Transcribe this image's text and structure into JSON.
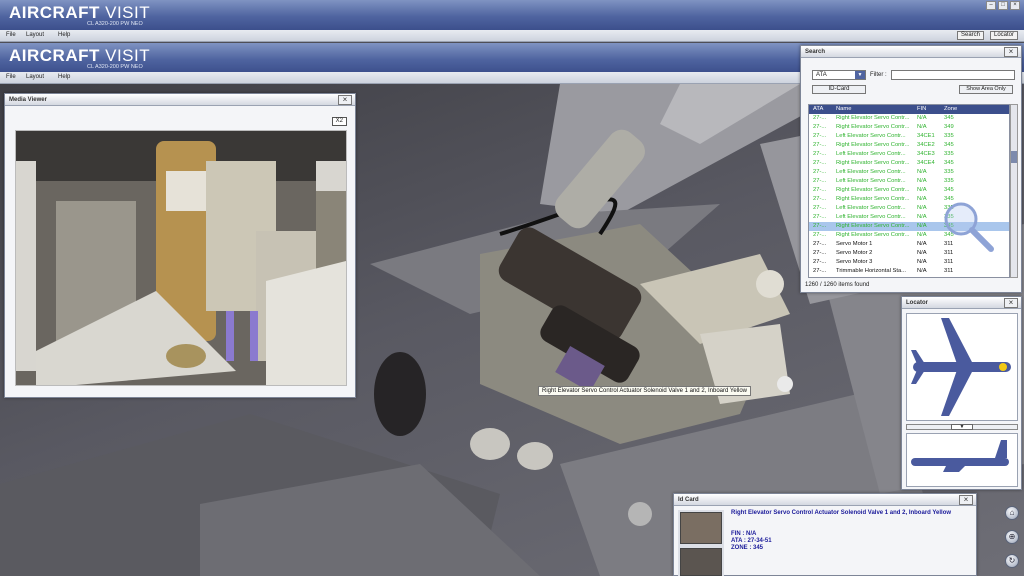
{
  "app": {
    "brand_main": "AIRCRAFT",
    "brand_second": "VISIT",
    "subtitle": "CL A320-200 PW NEO",
    "menu": [
      "File",
      "Layout",
      "Help"
    ],
    "search_btn": "Search",
    "locator_btn": "Locator"
  },
  "media_viewer": {
    "title": "Media Viewer",
    "zoom_label": "X2"
  },
  "search_panel": {
    "title": "Search",
    "ata_select": "ATA",
    "filter_label": "Filter :",
    "filter_value": "",
    "id_card_btn": "ID-Card",
    "show_area_btn": "Show Area Only",
    "columns": [
      "ATA",
      "Name",
      "FIN",
      "Zone"
    ],
    "rows": [
      {
        "ata": "27-...",
        "name": "Right Elevator Servo Contr...",
        "fin": "N/A",
        "zone": "345",
        "color": "green"
      },
      {
        "ata": "27-...",
        "name": "Right Elevator Servo Contr...",
        "fin": "N/A",
        "zone": "349",
        "color": "green"
      },
      {
        "ata": "27-...",
        "name": "Left Elevator Servo Contr...",
        "fin": "34CE1",
        "zone": "335",
        "color": "green"
      },
      {
        "ata": "27-...",
        "name": "Right Elevator Servo Contr...",
        "fin": "34CE2",
        "zone": "345",
        "color": "green"
      },
      {
        "ata": "27-...",
        "name": "Left Elevator Servo Contr...",
        "fin": "34CE3",
        "zone": "335",
        "color": "green"
      },
      {
        "ata": "27-...",
        "name": "Right Elevator Servo Contr...",
        "fin": "34CE4",
        "zone": "345",
        "color": "green"
      },
      {
        "ata": "27-...",
        "name": "Left Elevator Servo Contr...",
        "fin": "N/A",
        "zone": "335",
        "color": "green"
      },
      {
        "ata": "27-...",
        "name": "Left Elevator Servo Contr...",
        "fin": "N/A",
        "zone": "335",
        "color": "green"
      },
      {
        "ata": "27-...",
        "name": "Right Elevator Servo Contr...",
        "fin": "N/A",
        "zone": "345",
        "color": "green"
      },
      {
        "ata": "27-...",
        "name": "Right Elevator Servo Contr...",
        "fin": "N/A",
        "zone": "345",
        "color": "green"
      },
      {
        "ata": "27-...",
        "name": "Left Elevator Servo Contr...",
        "fin": "N/A",
        "zone": "335",
        "color": "green"
      },
      {
        "ata": "27-...",
        "name": "Left Elevator Servo Contr...",
        "fin": "N/A",
        "zone": "335",
        "color": "green"
      },
      {
        "ata": "27-...",
        "name": "Right Elevator Servo Contr...",
        "fin": "N/A",
        "zone": "345",
        "color": "green",
        "selected": true
      },
      {
        "ata": "27-...",
        "name": "Right Elevator Servo Contr...",
        "fin": "N/A",
        "zone": "345",
        "color": "green"
      },
      {
        "ata": "27-...",
        "name": "Servo Motor 1",
        "fin": "N/A",
        "zone": "311",
        "color": "black"
      },
      {
        "ata": "27-...",
        "name": "Servo Motor 2",
        "fin": "N/A",
        "zone": "311",
        "color": "black"
      },
      {
        "ata": "27-...",
        "name": "Servo Motor 3",
        "fin": "N/A",
        "zone": "311",
        "color": "black"
      },
      {
        "ata": "27-...",
        "name": "Trimmable Horizontal Sta...",
        "fin": "N/A",
        "zone": "311",
        "color": "black"
      }
    ],
    "status": "1260 / 1260 items found"
  },
  "locator": {
    "title": "Locator"
  },
  "tooltip": "Right Elevator Servo Control Actuator Solenoid Valve 1 and 2, Inboard Yellow",
  "id_card": {
    "title": "Id Card",
    "heading": "Right Elevator Servo Control Actuator Solenoid Valve 1 and 2, Inboard Yellow",
    "fin": "FIN : N/A",
    "ata": "ATA : 27-34-51",
    "zone": "ZONE : 345"
  },
  "colors": {
    "banner": "#4f64a0",
    "green_row": "#2fb32f",
    "selected_row": "#a9c6ec",
    "header_row": "#3c4f8c",
    "id_heading": "#1a1a9a",
    "aircraft": "#4a5a9e"
  }
}
